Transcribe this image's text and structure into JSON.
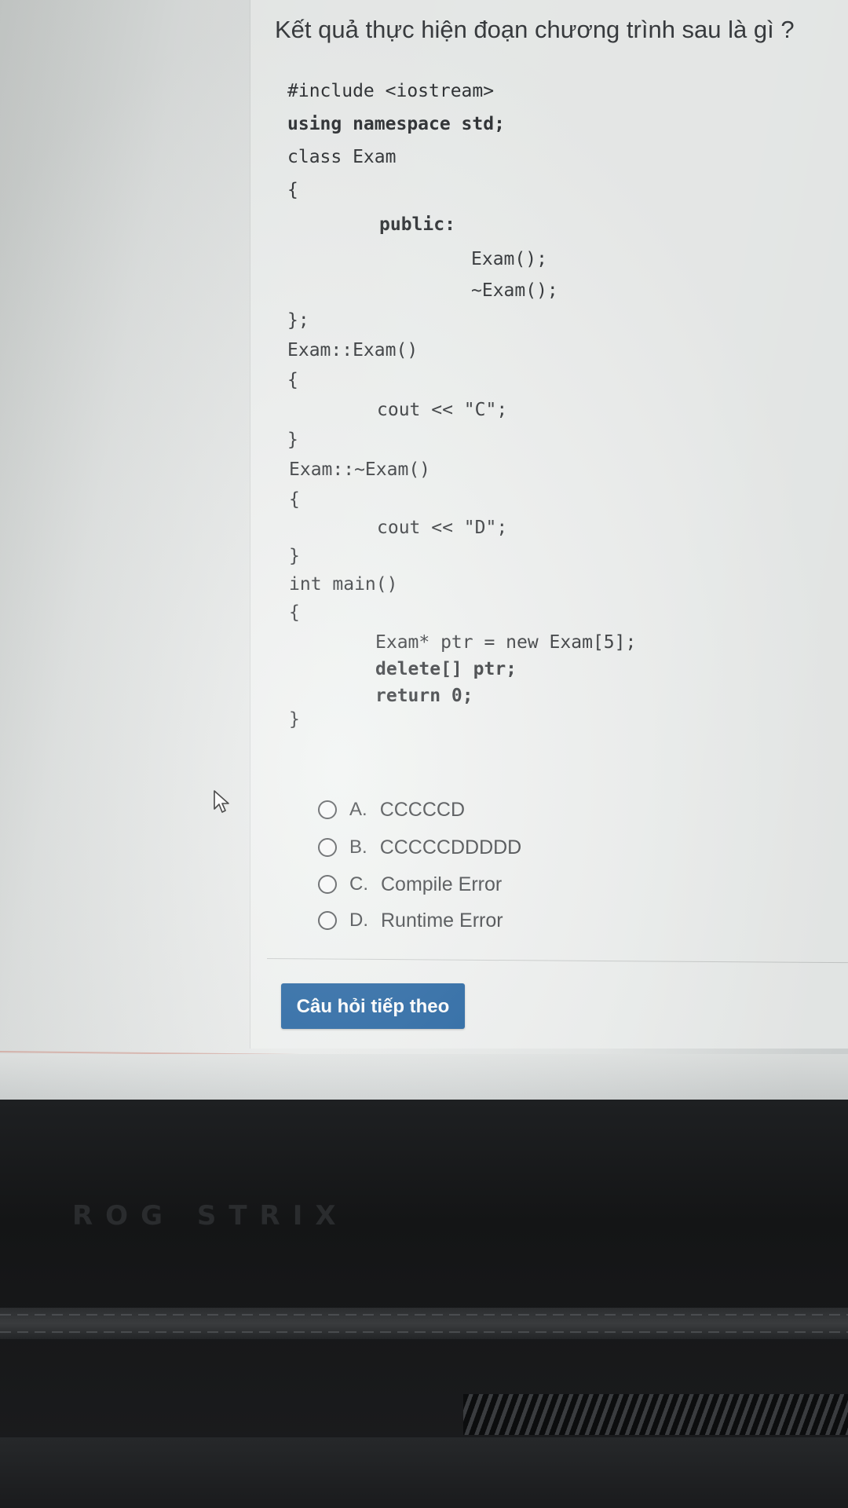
{
  "question": {
    "title": "Kết quả thực hiện đoạn chương trình sau là gì ?"
  },
  "code_lines": [
    "#include <iostream>",
    "using namespace std;",
    "class Exam",
    "{",
    "public:",
    "Exam();",
    "~Exam();",
    "};",
    "Exam::Exam()",
    "{",
    "cout << \"C\";",
    "}",
    "Exam::~Exam()",
    "{",
    "cout << \"D\";",
    "}",
    "int main()",
    "{",
    "Exam* ptr = new Exam[5];",
    "delete[] ptr;",
    "return 0;",
    "}"
  ],
  "answers": [
    {
      "letter": "A.",
      "text": "CCCCCD"
    },
    {
      "letter": "B.",
      "text": "CCCCCDDDDD"
    },
    {
      "letter": "C.",
      "text": "Compile Error"
    },
    {
      "letter": "D.",
      "text": "Runtime Error"
    }
  ],
  "next_button": {
    "label": "Câu hỏi tiếp theo",
    "color": "#195d9e"
  },
  "bezel": {
    "brand": "ROG STRIX"
  },
  "icons": {
    "cursor": "mouse-pointer-icon",
    "radio": "radio-unchecked-icon"
  }
}
